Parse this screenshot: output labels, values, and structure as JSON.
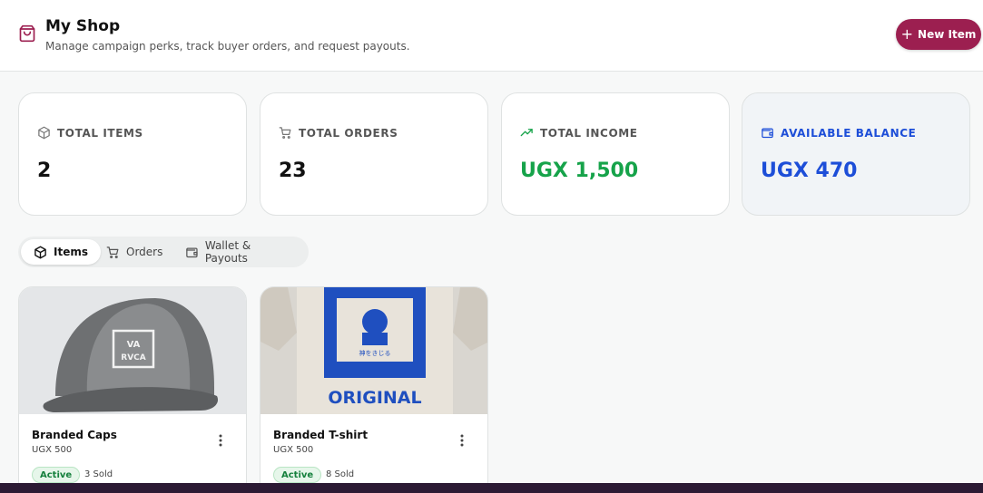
{
  "header": {
    "title": "My Shop",
    "subtitle": "Manage campaign perks, track buyer orders, and request payouts.",
    "new_item_label": "New Item",
    "accent": "#9c1f50"
  },
  "stats": [
    {
      "label": "TOTAL ITEMS",
      "value": "2",
      "icon": "box-icon"
    },
    {
      "label": "TOTAL ORDERS",
      "value": "23",
      "icon": "cart-icon"
    },
    {
      "label": "TOTAL INCOME",
      "value": "UGX 1,500",
      "icon": "trending-up-icon",
      "color": "#16a34a"
    },
    {
      "label": "AVAILABLE BALANCE",
      "value": "UGX 470",
      "icon": "wallet-icon",
      "color": "#1d4ed8"
    }
  ],
  "tabs": [
    {
      "label": "Items",
      "active": true,
      "icon": "box-icon"
    },
    {
      "label": "Orders",
      "active": false,
      "icon": "cart-icon"
    },
    {
      "label": "Wallet & Payouts",
      "active": false,
      "icon": "wallet-icon"
    }
  ],
  "items": [
    {
      "name": "Branded Caps",
      "price": "UGX 500",
      "status": "Active",
      "sold": "3 Sold",
      "image": "cap-image"
    },
    {
      "name": "Branded T-shirt",
      "price": "UGX 500",
      "status": "Active",
      "sold": "8 Sold",
      "image": "tshirt-image"
    }
  ]
}
